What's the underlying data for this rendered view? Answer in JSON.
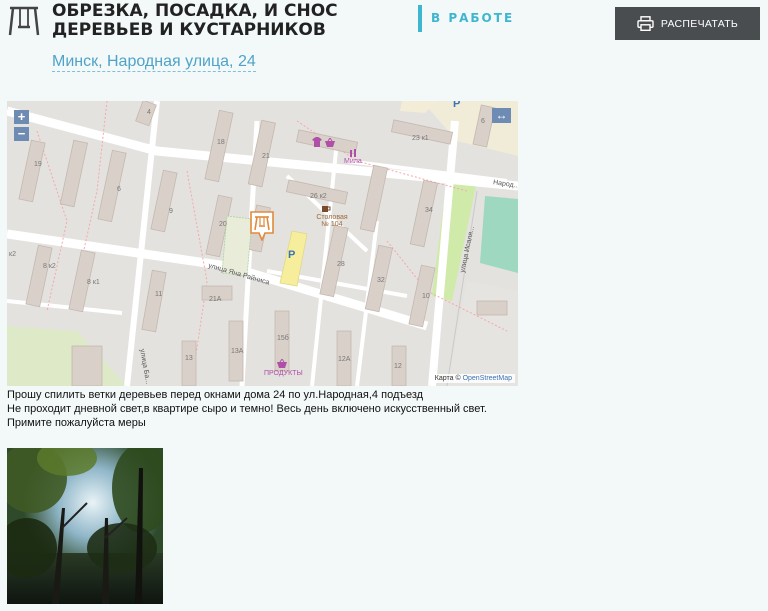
{
  "header": {
    "category_icon": "swing-icon",
    "title": "Обрезка, посадка, и снос деревьев и кустарников",
    "address": "Минск, Народная улица, 24",
    "status": "В работе",
    "print_label": "РАСПЕЧАТАТЬ",
    "print_icon": "printer-icon",
    "accent_color": "#3fb6cf"
  },
  "map": {
    "zoom_in": "+",
    "zoom_out": "−",
    "expand": "↔",
    "attribution_prefix": "Карта ©",
    "attribution_link": "OpenStreetMap",
    "marker_icon": "swing-icon",
    "streets": {
      "yana_raynisa": "улица Яна Райниса",
      "isaliamova": "улица Исаля...",
      "narodnaya": "Народ...",
      "street_bottom": "улица Ба..."
    },
    "buildings": [
      "4",
      "6",
      "23 к1",
      "19",
      "18",
      "21",
      "26 к2",
      "6",
      "9",
      "20",
      "8 к2",
      "8 к1",
      "34",
      "28",
      "10",
      "32",
      "11",
      "21А",
      "13",
      "13А",
      "15б",
      "12А",
      "12",
      "к2"
    ],
    "pois": {
      "mila": "Мила",
      "canteen": "Столовая № 104",
      "products": "ПРОДУКТЫ",
      "parking": "P"
    }
  },
  "description": {
    "line1": "Прошу спилить ветки деревьев перед окнами дома 24 по ул.Народная,4 подъезд",
    "line2": "Не проходит дневной свет,в квартире сыро и темно! Весь день включено искусственный свет. Примите пожалуйста меры"
  },
  "photo": {
    "label": "photo-thumbnail"
  }
}
